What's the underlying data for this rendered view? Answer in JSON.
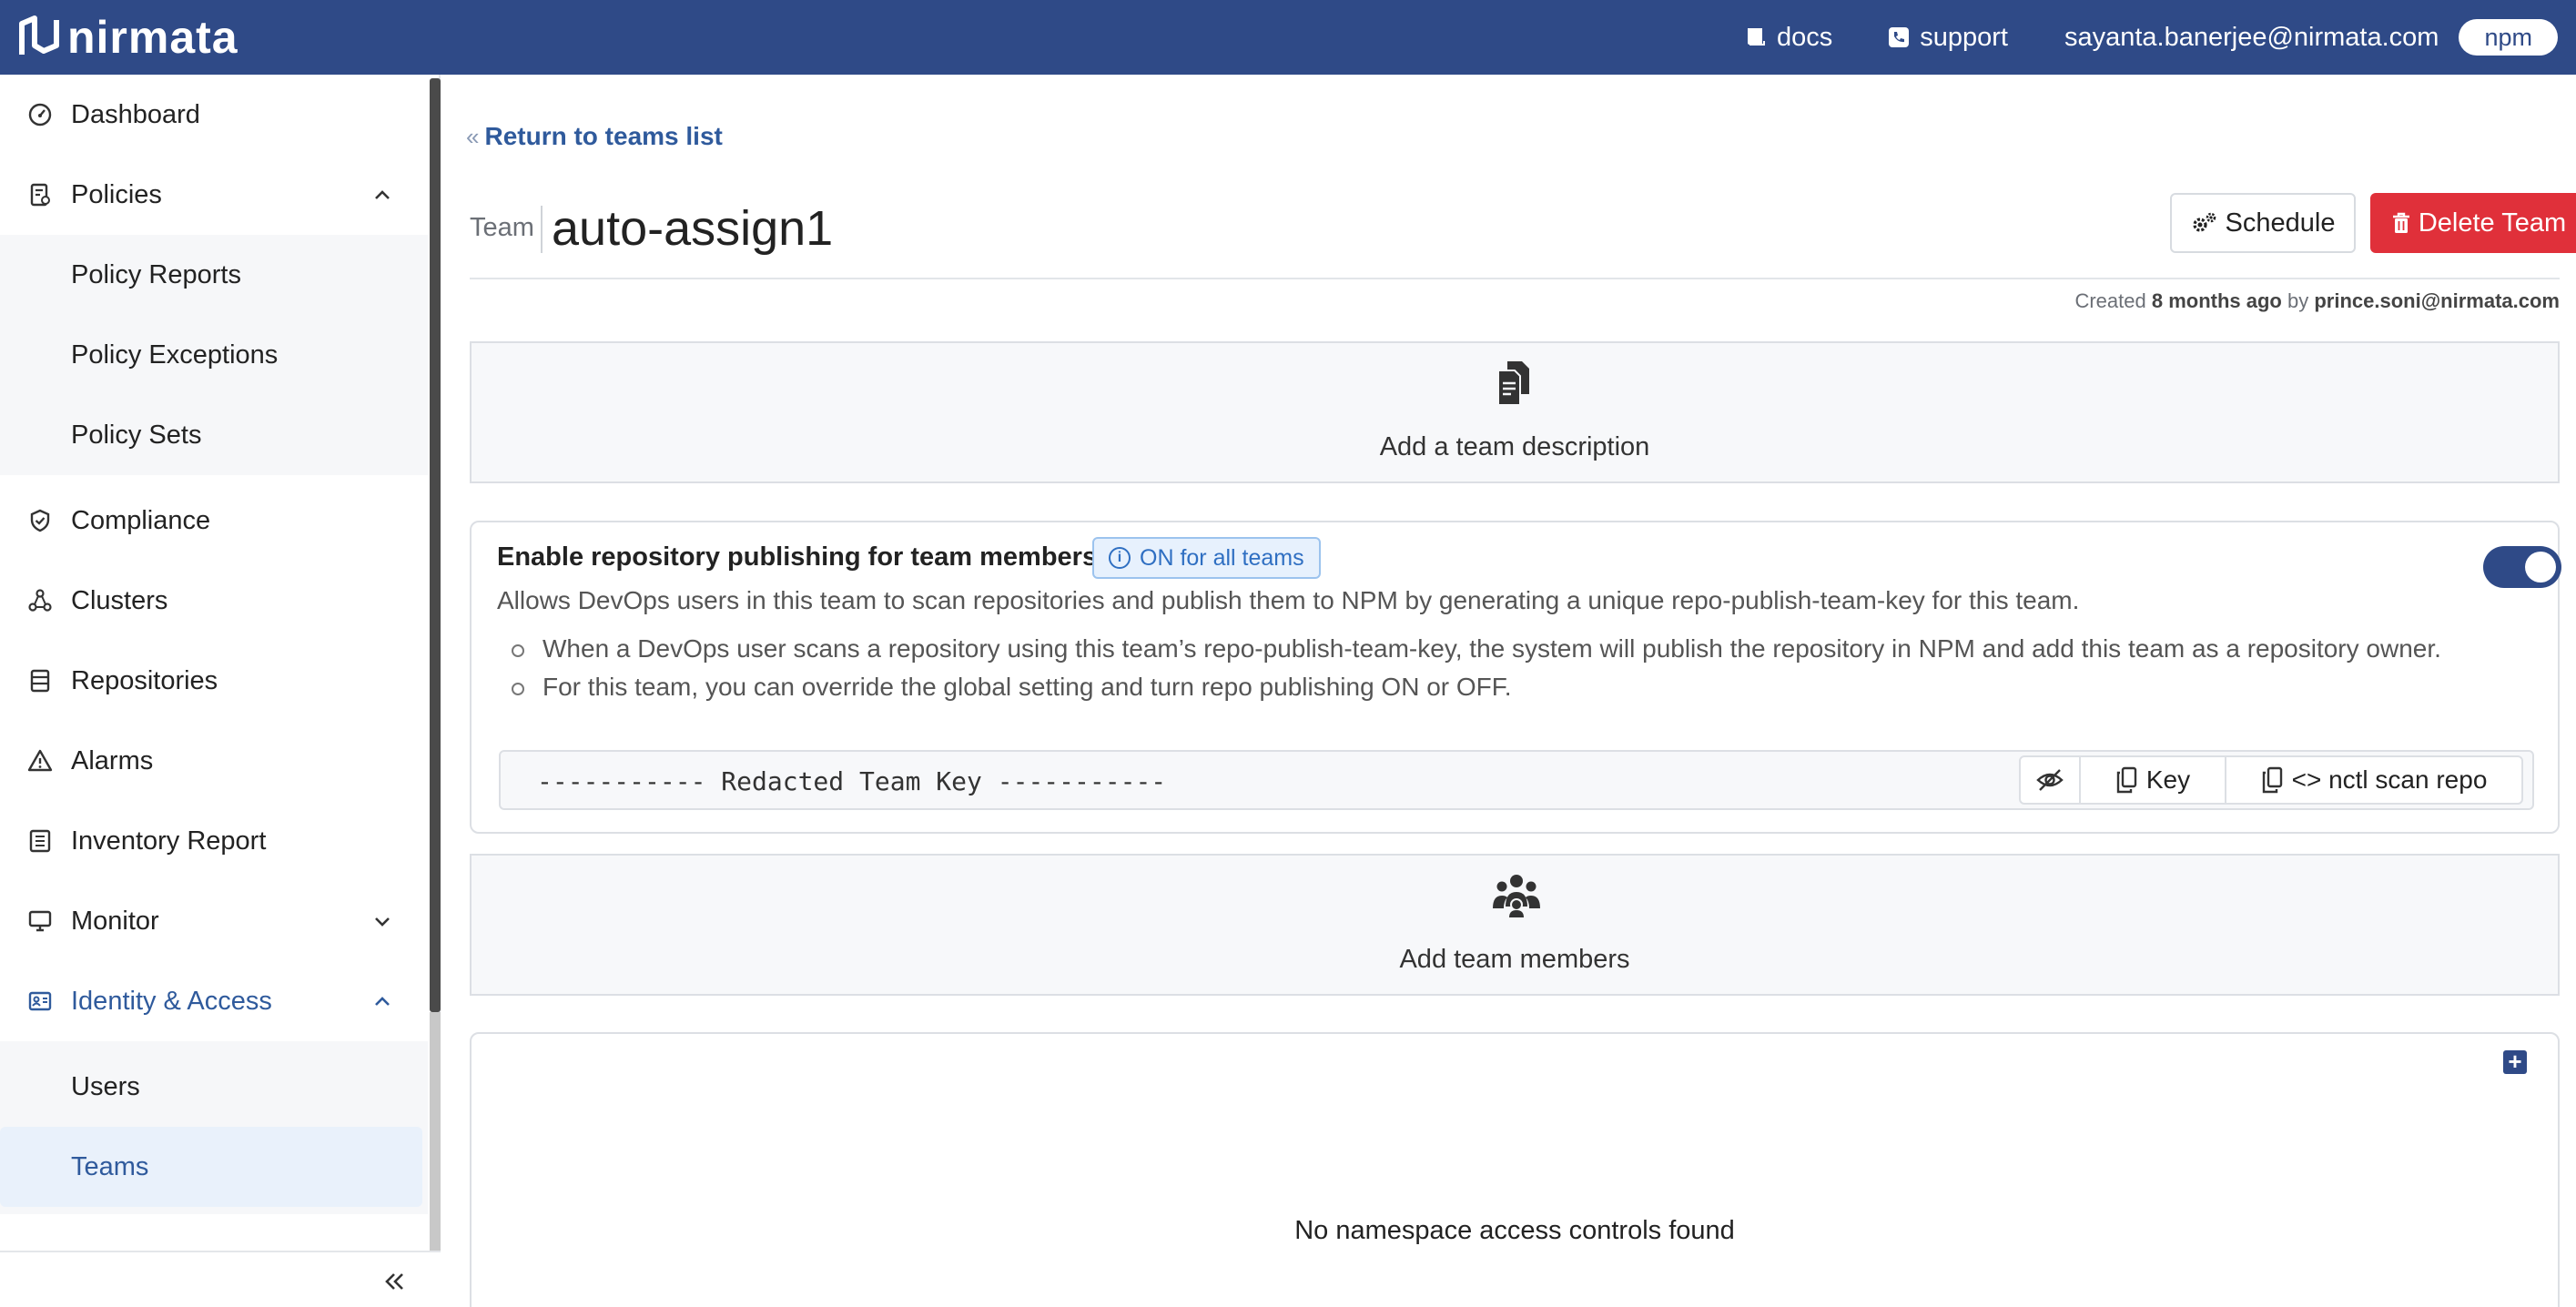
{
  "brand": {
    "name": "nirmata"
  },
  "topbar": {
    "docs_label": "docs",
    "support_label": "support",
    "user_email": "sayanta.banerjee@nirmata.com",
    "product_badge": "npm"
  },
  "sidebar": {
    "items": [
      {
        "label": "Dashboard",
        "icon": "gauge-icon"
      },
      {
        "label": "Policies",
        "icon": "policy-doc-icon",
        "expanded": true
      },
      {
        "label": "Compliance",
        "icon": "shield-check-icon"
      },
      {
        "label": "Clusters",
        "icon": "cluster-icon"
      },
      {
        "label": "Repositories",
        "icon": "repository-icon"
      },
      {
        "label": "Alarms",
        "icon": "warning-icon"
      },
      {
        "label": "Inventory Report",
        "icon": "list-icon"
      },
      {
        "label": "Monitor",
        "icon": "monitor-icon",
        "expanded": false
      },
      {
        "label": "Identity & Access",
        "icon": "id-card-icon",
        "expanded": true
      }
    ],
    "policies_sub": [
      "Policy Reports",
      "Policy Exceptions",
      "Policy Sets"
    ],
    "identity_sub": [
      "Users",
      "Teams"
    ],
    "active_item": "Teams"
  },
  "page": {
    "back_link": "Return to teams list",
    "team_label": "Team",
    "team_name": "auto-assign1",
    "schedule_button": "Schedule",
    "delete_button": "Delete Team",
    "created_prefix": "Created",
    "created_when": "8 months ago",
    "created_by_word": "by",
    "created_by": "prince.soni@nirmata.com"
  },
  "description_panel": {
    "text": "Add a team description"
  },
  "repo_publishing": {
    "title": "Enable repository publishing for team members",
    "badge": "ON for all teams",
    "enabled": true,
    "description": "Allows DevOps users in this team to scan repositories and publish them to NPM by generating a unique repo-publish-team-key for this team.",
    "bullets": [
      "When a DevOps user scans a repository using this team’s repo-publish-team-key, the system will publish the repository in NPM and add this team as a repository owner.",
      "For this team, you can override the global setting and turn repo publishing ON or OFF."
    ],
    "key_text": "----------- Redacted Team Key -----------",
    "key_button": "Key",
    "scan_button": "<> nctl scan repo"
  },
  "members_panel": {
    "text": "Add team members"
  },
  "namespace_panel": {
    "empty_text": "No namespace access controls found"
  },
  "colors": {
    "brand": "#2f4a87",
    "danger": "#e0303a",
    "active_nav": "#2f5a9c",
    "active_nav_bg": "#e9f1fb"
  }
}
